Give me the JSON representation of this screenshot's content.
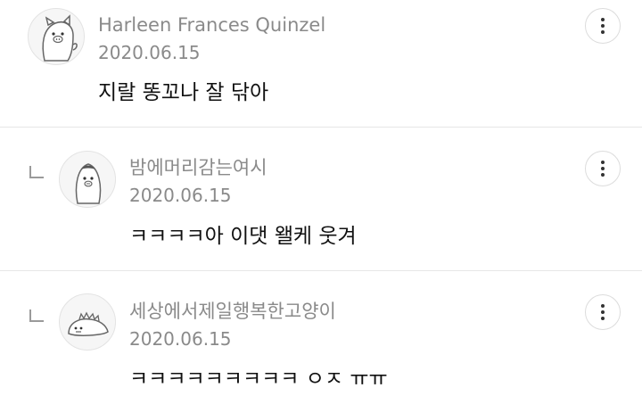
{
  "comments": [
    {
      "author": "Harleen Frances Quinzel",
      "date": "2020.06.15",
      "text": "지랄 똥꼬나 잘 닦아",
      "avatar_icon": "pig-character-icon",
      "is_reply": false
    },
    {
      "author": "밤에머리감는여시",
      "date": "2020.06.15",
      "text": "ㅋㅋㅋㅋ아 이댓 왤케 웃겨",
      "avatar_icon": "penguin-character-icon",
      "is_reply": true
    },
    {
      "author": "세상에서제일행복한고양이",
      "date": "2020.06.15",
      "text": "ㅋㅋㅋㅋㅋㅋㅋㅋㅋ ㅇㅈ ㅠㅠ",
      "avatar_icon": "dinosaur-character-icon",
      "is_reply": true
    }
  ],
  "icons": {
    "more": "vertical-ellipsis-icon",
    "reply": "reply-arrow-icon"
  },
  "colors": {
    "meta_text": "#8a8a8a",
    "body_text": "#111111",
    "divider": "#e6e6e6"
  }
}
